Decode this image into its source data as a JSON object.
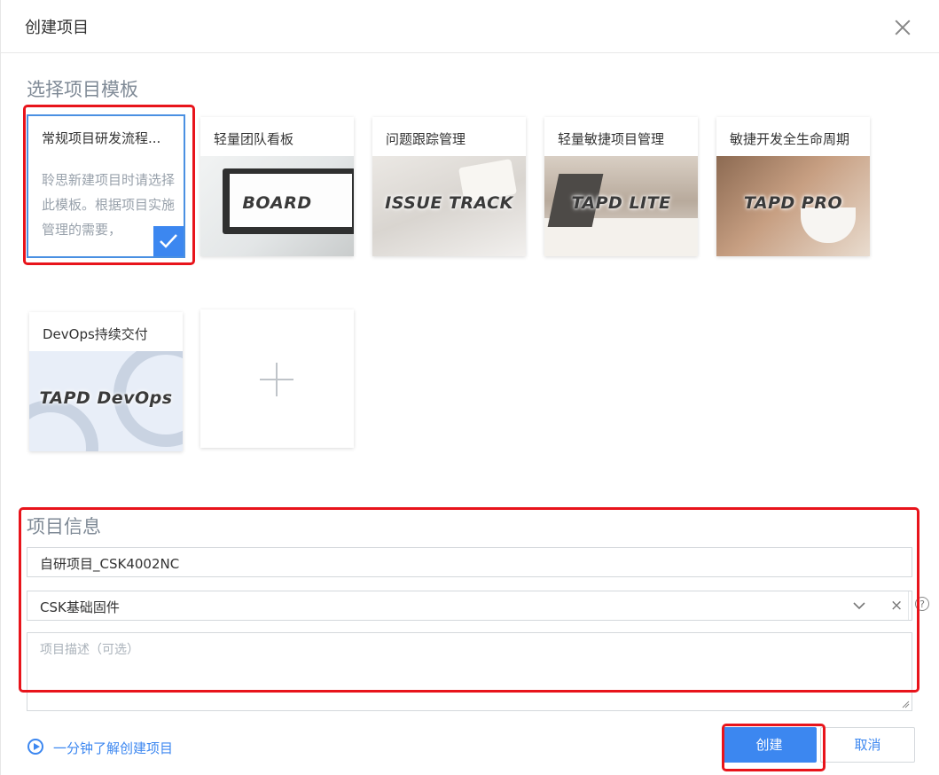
{
  "dialog": {
    "title": "创建项目"
  },
  "templates": {
    "section_title": "选择项目模板",
    "selected": {
      "title": "常规项目研发流程...",
      "description": "聆思新建项目时请选择此模板。根据项目实施管理的需要，"
    },
    "cards": [
      {
        "title": "轻量团队看板",
        "image_label": "BOARD"
      },
      {
        "title": "问题跟踪管理",
        "image_label": "ISSUE TRACK"
      },
      {
        "title": "轻量敏捷项目管理",
        "image_label": "TAPD LITE"
      },
      {
        "title": "敏捷开发全生命周期",
        "image_label": "TAPD PRO"
      },
      {
        "title": "DevOps持续交付",
        "image_label": "TAPD DevOps"
      }
    ]
  },
  "info": {
    "section_title": "项目信息",
    "name_value": "自研项目_CSK4002NC",
    "category_value": "CSK基础固件",
    "clear_glyph": "×",
    "help_glyph": "?",
    "description_placeholder": "项目描述（可选）"
  },
  "footer": {
    "help_link": "一分钟了解创建项目",
    "create_label": "创建",
    "cancel_label": "取消"
  },
  "colors": {
    "accent": "#3c87f0",
    "highlight": "#e8141b"
  }
}
